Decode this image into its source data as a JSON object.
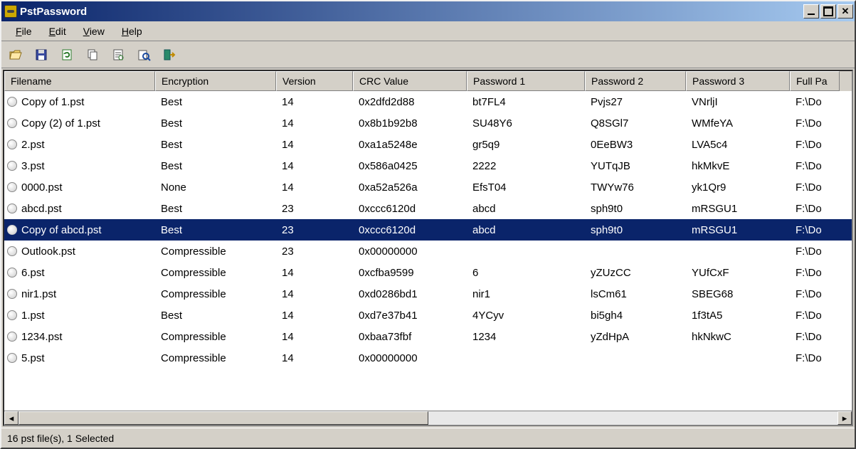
{
  "title": "PstPassword",
  "menubar": [
    {
      "label": "File",
      "underline": "F"
    },
    {
      "label": "Edit",
      "underline": "E"
    },
    {
      "label": "View",
      "underline": "V"
    },
    {
      "label": "Help",
      "underline": "H"
    }
  ],
  "toolbar_icons": [
    "open-file-icon",
    "save-icon",
    "refresh-icon",
    "copy-icon",
    "properties-icon",
    "find-icon",
    "exit-icon"
  ],
  "columns": [
    "Filename",
    "Encryption",
    "Version",
    "CRC Value",
    "Password 1",
    "Password 2",
    "Password 3",
    "Full Pa"
  ],
  "rows": [
    {
      "selected": false,
      "cells": [
        "Copy of 1.pst",
        "Best",
        "14",
        "0x2dfd2d88",
        "bt7FL4",
        "Pvjs27",
        "VNrljI",
        "F:\\Do"
      ]
    },
    {
      "selected": false,
      "cells": [
        "Copy (2) of 1.pst",
        "Best",
        "14",
        "0x8b1b92b8",
        "SU48Y6",
        "Q8SGl7",
        "WMfeYA",
        "F:\\Do"
      ]
    },
    {
      "selected": false,
      "cells": [
        "2.pst",
        "Best",
        "14",
        "0xa1a5248e",
        "gr5q9",
        "0EeBW3",
        "LVA5c4",
        "F:\\Do"
      ]
    },
    {
      "selected": false,
      "cells": [
        "3.pst",
        "Best",
        "14",
        "0x586a0425",
        "2222",
        "YUTqJB",
        "hkMkvE",
        "F:\\Do"
      ]
    },
    {
      "selected": false,
      "cells": [
        "0000.pst",
        "None",
        "14",
        "0xa52a526a",
        "EfsT04",
        "TWYw76",
        "yk1Qr9",
        "F:\\Do"
      ]
    },
    {
      "selected": false,
      "cells": [
        "abcd.pst",
        "Best",
        "23",
        "0xccc6120d",
        "abcd",
        "sph9t0",
        "mRSGU1",
        "F:\\Do"
      ]
    },
    {
      "selected": true,
      "cells": [
        "Copy of abcd.pst",
        "Best",
        "23",
        "0xccc6120d",
        "abcd",
        "sph9t0",
        "mRSGU1",
        "F:\\Do"
      ]
    },
    {
      "selected": false,
      "cells": [
        "Outlook.pst",
        "Compressible",
        "23",
        "0x00000000",
        "",
        "",
        "",
        "F:\\Do"
      ]
    },
    {
      "selected": false,
      "cells": [
        "6.pst",
        "Compressible",
        "14",
        "0xcfba9599",
        "6",
        "yZUzCC",
        "YUfCxF",
        "F:\\Do"
      ]
    },
    {
      "selected": false,
      "cells": [
        "nir1.pst",
        "Compressible",
        "14",
        "0xd0286bd1",
        "nir1",
        "lsCm61",
        "SBEG68",
        "F:\\Do"
      ]
    },
    {
      "selected": false,
      "cells": [
        "1.pst",
        "Best",
        "14",
        "0xd7e37b41",
        "4YCyv",
        "bi5gh4",
        "1f3tA5",
        "F:\\Do"
      ]
    },
    {
      "selected": false,
      "cells": [
        "1234.pst",
        "Compressible",
        "14",
        "0xbaa73fbf",
        "1234",
        "yZdHpA",
        "hkNkwC",
        "F:\\Do"
      ]
    },
    {
      "selected": false,
      "cells": [
        "5.pst",
        "Compressible",
        "14",
        "0x00000000",
        "",
        "",
        "",
        "F:\\Do"
      ]
    }
  ],
  "status": "16 pst file(s), 1 Selected"
}
